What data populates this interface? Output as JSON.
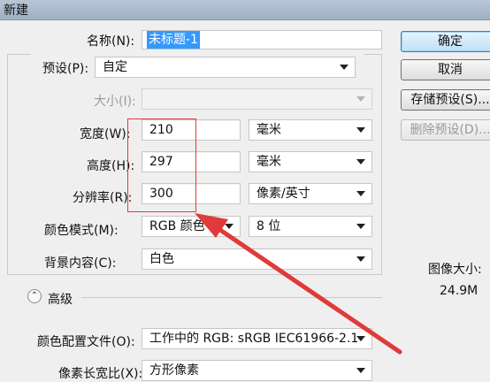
{
  "window": {
    "title": "新建"
  },
  "form": {
    "name_label": "名称(N):",
    "name_value": "未标题-1",
    "preset_label": "预设(P):",
    "preset_value": "自定",
    "size_label": "大小(I):",
    "size_value": "",
    "width_label": "宽度(W):",
    "width_value": "210",
    "width_unit": "毫米",
    "height_label": "高度(H):",
    "height_value": "297",
    "height_unit": "毫米",
    "resolution_label": "分辨率(R):",
    "resolution_value": "300",
    "resolution_unit": "像素/英寸",
    "color_mode_label": "颜色模式(M):",
    "color_mode_value": "RGB 颜色",
    "bit_depth_value": "8 位",
    "background_label": "背景内容(C):",
    "background_value": "白色"
  },
  "advanced": {
    "label": "高级",
    "color_profile_label": "颜色配置文件(O):",
    "color_profile_value": "工作中的 RGB: sRGB IEC61966-2.1",
    "pixel_aspect_label": "像素长宽比(X):",
    "pixel_aspect_value": "方形像素"
  },
  "buttons": {
    "ok": "确定",
    "cancel": "取消",
    "save_preset": "存储预设(S)...",
    "delete_preset": "删除预设(D)..."
  },
  "image_size": {
    "label": "图像大小:",
    "value": "24.9M"
  },
  "annotation": {
    "color": "#e03a3a"
  }
}
